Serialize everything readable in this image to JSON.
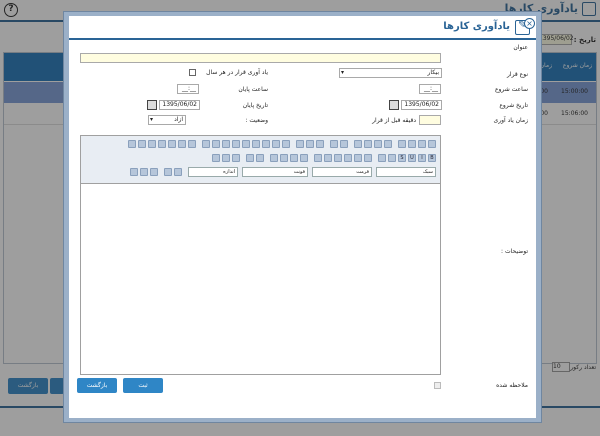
{
  "background": {
    "title": "یادآوری کارها",
    "help_icon": "?",
    "date_label": "تاریخ :",
    "date_value": "1395/06/02",
    "grid": {
      "columns": [
        "زمان شروع",
        "زمان پایان"
      ],
      "rows": [
        {
          "start": "15:00:00",
          "end": "16:30:00"
        },
        {
          "start": "15:06:00",
          "end": "16:30:00"
        }
      ]
    },
    "pager_label": "تعداد رکورد :",
    "pager_value": "10",
    "back_button": "بازگشت"
  },
  "modal": {
    "title": "یادآوری کارها",
    "close_icon": "×",
    "fields": {
      "subject_label": "عنوان",
      "meeting_type_label": "نوع قرار",
      "meeting_type_value": "بیکار",
      "repeat_label": "یاد آوری قرار در هر سال",
      "start_time_label": "ساعت شروع",
      "start_time_value": "__:__",
      "end_time_label": "ساعت پایان",
      "end_time_value": "__:__",
      "start_date_label": "تاریخ شروع",
      "start_date_value": "1395/06/02",
      "end_date_label": "تاریخ پایان",
      "end_date_value": "1395/06/02",
      "reminder_label": "زمان یاد آوری",
      "reminder_unit": "دقیقه قبل از قرار",
      "status_label": "وضعیت :",
      "status_value": "آزاد",
      "description_label": "توضیحات :",
      "seen_label": "ملاحظه شده"
    },
    "editor": {
      "style_select": "سبک",
      "format_select": "فرمت",
      "font_select": "فونت",
      "size_select": "اندازه"
    },
    "buttons": {
      "submit": "ثبت",
      "back": "بازگشت"
    }
  },
  "colors": {
    "accent": "#2a6496",
    "header_blue": "#1c74b8",
    "selected_row": "#7b9bd8",
    "button": "#2f86c6"
  }
}
